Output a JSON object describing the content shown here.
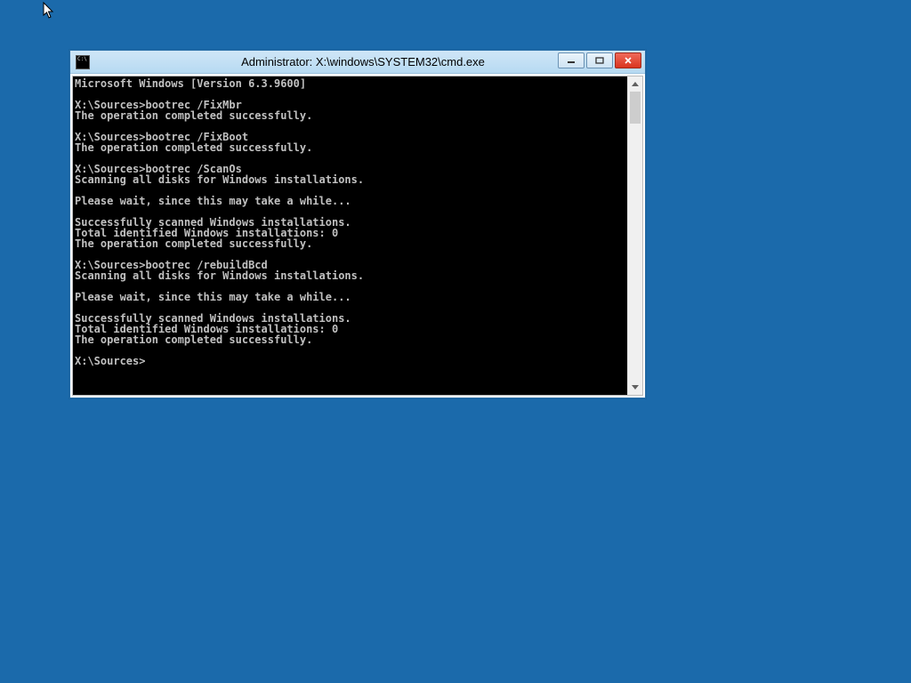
{
  "window": {
    "title": "Administrator: X:\\windows\\SYSTEM32\\cmd.exe"
  },
  "terminal": {
    "lines": [
      "Microsoft Windows [Version 6.3.9600]",
      "",
      "X:\\Sources>bootrec /FixMbr",
      "The operation completed successfully.",
      "",
      "X:\\Sources>bootrec /FixBoot",
      "The operation completed successfully.",
      "",
      "X:\\Sources>bootrec /ScanOs",
      "Scanning all disks for Windows installations.",
      "",
      "Please wait, since this may take a while...",
      "",
      "Successfully scanned Windows installations.",
      "Total identified Windows installations: 0",
      "The operation completed successfully.",
      "",
      "X:\\Sources>bootrec /rebuildBcd",
      "Scanning all disks for Windows installations.",
      "",
      "Please wait, since this may take a while...",
      "",
      "Successfully scanned Windows installations.",
      "Total identified Windows installations: 0",
      "The operation completed successfully.",
      "",
      "X:\\Sources>"
    ]
  },
  "controls": {
    "minimize": "−",
    "maximize": "□",
    "close": "×"
  }
}
